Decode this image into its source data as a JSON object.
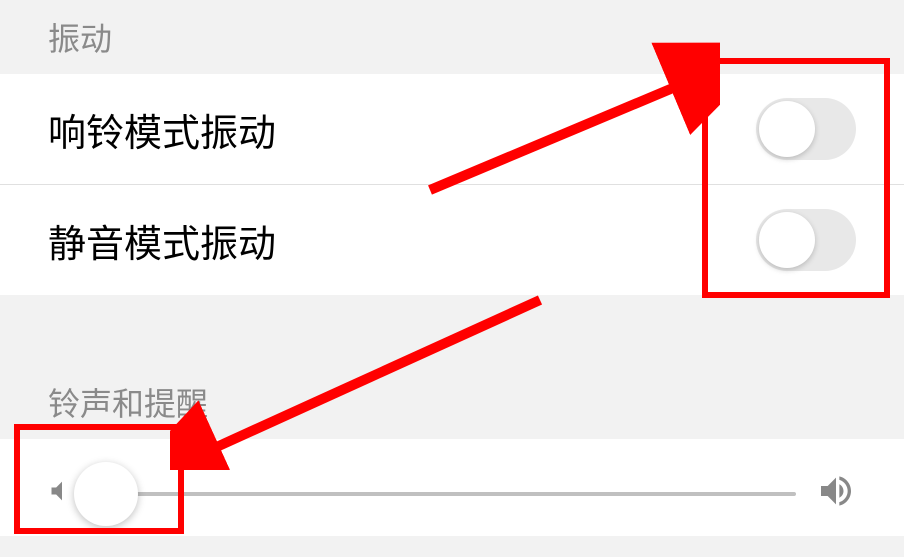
{
  "sections": {
    "vibration": {
      "header": "振动",
      "ring_mode": {
        "label": "响铃模式振动",
        "enabled": false
      },
      "silent_mode": {
        "label": "静音模式振动",
        "enabled": false
      }
    },
    "ringtone": {
      "header": "铃声和提醒",
      "volume_percent": 2
    }
  },
  "annotations": {
    "highlight1": "toggles-area",
    "highlight2": "slider-thumb-area"
  }
}
